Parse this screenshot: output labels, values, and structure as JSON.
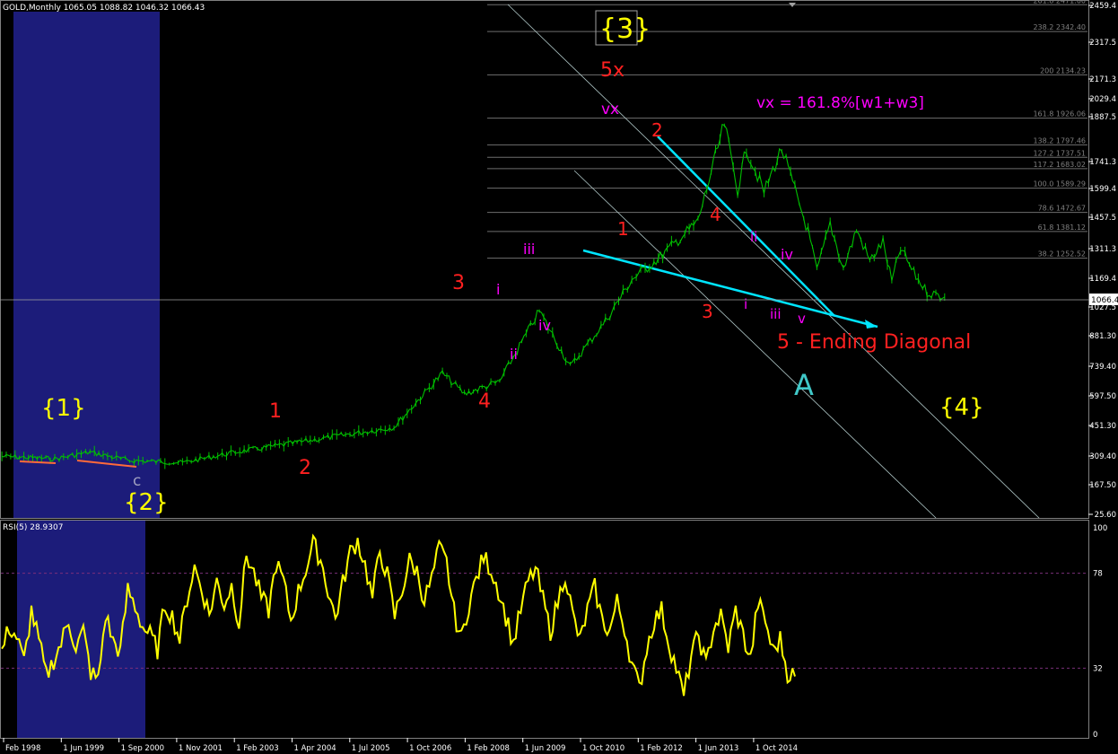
{
  "main_header": "GOLD,Monthly  1065.05 1088.82 1046.32 1066.43",
  "rsi_header": "RSI(5) 28.9307",
  "current_price_label": "1066.4",
  "chart_data": {
    "type": "line",
    "price_axis_ticks": [
      "2459.4",
      "2317.5",
      "2171.3",
      "2029.4",
      "1887.5",
      "1741.3",
      "1599.4",
      "1457.5",
      "1311.3",
      "1169.4",
      "1027.5",
      "881.30",
      "739.40",
      "597.50",
      "451.30",
      "309.40",
      "167.50",
      "25.60"
    ],
    "rsi_axis_ticks": [
      "100",
      "78",
      "32",
      "0"
    ],
    "rsi_levels": [
      78,
      32
    ],
    "date_ticks": [
      "Feb 1998",
      "1 Jun 1999",
      "1 Sep 2000",
      "1 Nov 2001",
      "1 Feb 2003",
      "1 Apr 2004",
      "1 Jul 2005",
      "1 Oct 2006",
      "1 Feb 2008",
      "1 Jun 2009",
      "1 Oct 2010",
      "1 Feb 2012",
      "1 Jun 2013",
      "1 Oct 2014"
    ],
    "fib_levels": [
      {
        "label": "261.8 2471.00",
        "price": 2471.0
      },
      {
        "label": "238.2 2342.40",
        "price": 2342.4
      },
      {
        "label": "200 2134.23",
        "price": 2134.23
      },
      {
        "label": "161.8 1926.06",
        "price": 1926.06
      },
      {
        "label": "138.2 1797.46",
        "price": 1797.46
      },
      {
        "label": "127.2 1737.51",
        "price": 1737.51
      },
      {
        "label": "117.2 1683.02",
        "price": 1683.02
      },
      {
        "label": "100.0 1589.29",
        "price": 1589.29
      },
      {
        "label": "78.6 1472.67",
        "price": 1472.67
      },
      {
        "label": "61.8 1381.12",
        "price": 1381.12
      },
      {
        "label": "38.2 1252.52",
        "price": 1252.52
      }
    ],
    "price_series": [
      {
        "date": "1998-01",
        "price": 300
      },
      {
        "date": "1999-01",
        "price": 288
      },
      {
        "date": "1999-09",
        "price": 320
      },
      {
        "date": "2000-06",
        "price": 280
      },
      {
        "date": "2001-06",
        "price": 270
      },
      {
        "date": "2002-06",
        "price": 320
      },
      {
        "date": "2003-06",
        "price": 360
      },
      {
        "date": "2004-06",
        "price": 400
      },
      {
        "date": "2005-06",
        "price": 440
      },
      {
        "date": "2006-05",
        "price": 700
      },
      {
        "date": "2006-10",
        "price": 600
      },
      {
        "date": "2007-06",
        "price": 660
      },
      {
        "date": "2008-03",
        "price": 1000
      },
      {
        "date": "2008-10",
        "price": 730
      },
      {
        "date": "2009-06",
        "price": 950
      },
      {
        "date": "2009-12",
        "price": 1150
      },
      {
        "date": "2010-06",
        "price": 1250
      },
      {
        "date": "2011-03",
        "price": 1430
      },
      {
        "date": "2011-09",
        "price": 1900
      },
      {
        "date": "2011-12",
        "price": 1580
      },
      {
        "date": "2012-02",
        "price": 1780
      },
      {
        "date": "2012-06",
        "price": 1570
      },
      {
        "date": "2012-10",
        "price": 1780
      },
      {
        "date": "2013-04",
        "price": 1380
      },
      {
        "date": "2013-06",
        "price": 1190
      },
      {
        "date": "2013-09",
        "price": 1420
      },
      {
        "date": "2013-12",
        "price": 1200
      },
      {
        "date": "2014-03",
        "price": 1390
      },
      {
        "date": "2014-06",
        "price": 1240
      },
      {
        "date": "2014-09",
        "price": 1330
      },
      {
        "date": "2014-11",
        "price": 1140
      },
      {
        "date": "2015-01",
        "price": 1300
      },
      {
        "date": "2015-04",
        "price": 1180
      },
      {
        "date": "2015-07",
        "price": 1090
      },
      {
        "date": "2015-11",
        "price": 1066
      }
    ],
    "rsi_series": [
      40,
      52,
      47,
      35,
      60,
      45,
      28,
      36,
      44,
      55,
      42,
      50,
      30,
      26,
      58,
      45,
      40,
      70,
      62,
      52,
      48,
      41,
      63,
      57,
      46,
      66,
      81,
      70,
      58,
      74,
      63,
      72,
      54,
      87,
      78,
      66,
      60,
      83,
      74,
      55,
      69,
      80,
      92,
      85,
      70,
      56,
      73,
      88,
      94,
      82,
      66,
      89,
      77,
      57,
      70,
      84,
      79,
      65,
      75,
      90,
      83,
      59,
      46,
      63,
      75,
      86,
      80,
      70,
      57,
      44,
      60,
      74,
      80,
      65,
      50,
      64,
      78,
      58,
      45,
      60,
      71,
      55,
      50,
      64,
      52,
      34,
      22,
      42,
      55,
      60,
      44,
      32,
      18,
      38,
      48,
      33,
      52,
      57,
      42,
      60,
      48,
      36,
      64,
      55,
      40,
      46,
      30,
      28
    ],
    "wave_labels": [
      {
        "text": "{3}",
        "color": "#ffff00"
      },
      {
        "text": "5x",
        "color": "#ff2020"
      },
      {
        "text": "vx",
        "color": "#ff00ff"
      },
      {
        "text": "vx = 161.8%[w1+w3]",
        "color": "#ff00ff"
      },
      {
        "text": "2",
        "color": "#ff2020"
      },
      {
        "text": "1",
        "color": "#ff2020"
      },
      {
        "text": "4",
        "color": "#ff2020"
      },
      {
        "text": "3",
        "color": "#ff2020"
      },
      {
        "text": "iii",
        "color": "#ff00ff"
      },
      {
        "text": "i",
        "color": "#ff00ff"
      },
      {
        "text": "ii",
        "color": "#ff00ff"
      },
      {
        "text": "iv",
        "color": "#ff00ff"
      },
      {
        "text": "3",
        "color": "#ff2020"
      },
      {
        "text": "4",
        "color": "#ff2020"
      },
      {
        "text": "ii",
        "color": "#ff00ff"
      },
      {
        "text": "iv",
        "color": "#ff00ff"
      },
      {
        "text": "i",
        "color": "#ff00ff"
      },
      {
        "text": "iii",
        "color": "#ff00ff"
      },
      {
        "text": "v",
        "color": "#ff00ff"
      },
      {
        "text": "5 - Ending Diagonal",
        "color": "#ff2020"
      },
      {
        "text": "A",
        "color": "#40c8c8"
      },
      {
        "text": "{4}",
        "color": "#ffff00"
      },
      {
        "text": "{1}",
        "color": "#ffff00"
      },
      {
        "text": "{2}",
        "color": "#ffff00"
      },
      {
        "text": "c",
        "color": "#a0a0c0"
      },
      {
        "text": "1",
        "color": "#ff2020"
      },
      {
        "text": "2",
        "color": "#ff2020"
      }
    ]
  },
  "colors": {
    "background": "#000000",
    "price": "#00c000",
    "rsi": "#ffff00",
    "highlight": "#1c1c7a",
    "wave_red": "#ff2020",
    "wave_magenta": "#ff00ff",
    "wave_yellow": "#ffff00",
    "trend": "#00e5ff",
    "channel": "#b0c8c8",
    "fib": "#6e6e6e",
    "rsi_level": "#7a2f7a"
  }
}
